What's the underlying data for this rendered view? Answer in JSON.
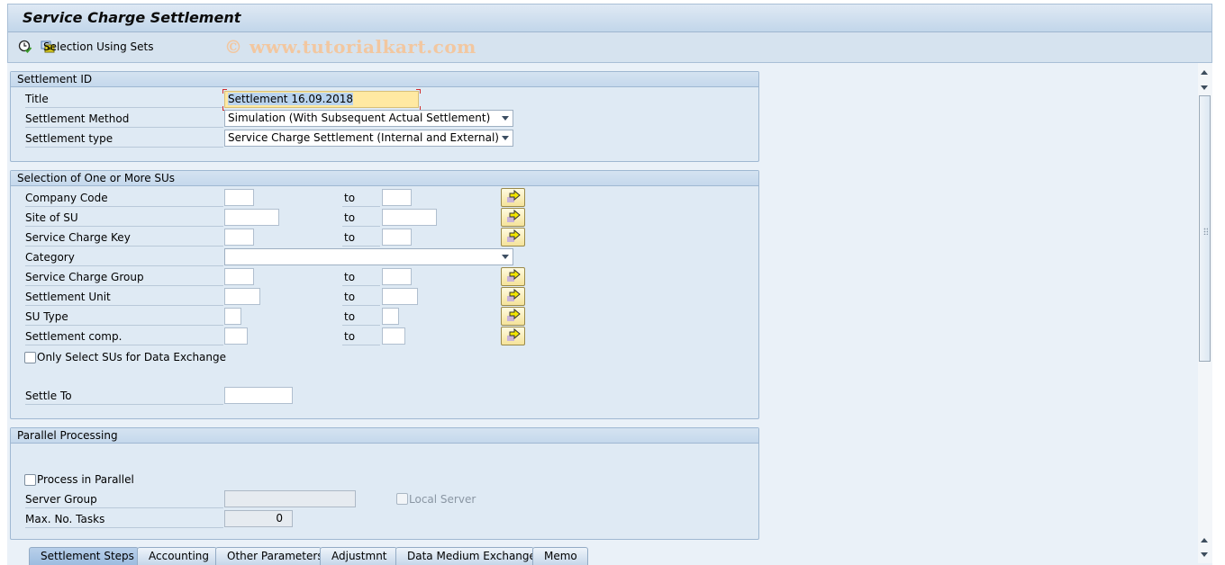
{
  "window": {
    "title": "Service Charge Settlement"
  },
  "toolbar": {
    "execute_icon": "execute-clock-icon",
    "selection_sets_label": "Selection Using Sets",
    "selection_sets_icon": "selection-sets-icon",
    "watermark": "© www.tutorialkart.com"
  },
  "settlement_id": {
    "header": "Settlement ID",
    "title_label": "Title",
    "title_value": "Settlement 16.09.2018",
    "method_label": "Settlement Method",
    "method_value": "Simulation (With Subsequent Actual Settlement)",
    "type_label": "Settlement type",
    "type_value": "Service Charge Settlement (Internal and External)"
  },
  "selection": {
    "header": "Selection of One or More SUs",
    "to_label": "to",
    "rows": [
      {
        "label": "Company Code",
        "from": "",
        "to": ""
      },
      {
        "label": "Site of SU",
        "from": "",
        "to": ""
      },
      {
        "label": "Service Charge Key",
        "from": "",
        "to": ""
      },
      {
        "label": "Category",
        "value": ""
      },
      {
        "label": "Service Charge Group",
        "from": "",
        "to": ""
      },
      {
        "label": "Settlement Unit",
        "from": "",
        "to": ""
      },
      {
        "label": "SU Type",
        "from": "",
        "to": ""
      },
      {
        "label": "Settlement comp.",
        "from": "",
        "to": ""
      }
    ],
    "data_exchange_label": "Only Select SUs for Data Exchange",
    "data_exchange_checked": false,
    "settle_to_label": "Settle To",
    "settle_to_value": ""
  },
  "parallel": {
    "header": "Parallel Processing",
    "process_label": "Process in Parallel",
    "process_checked": false,
    "server_group_label": "Server Group",
    "server_group_value": "",
    "local_server_label": "Local Server",
    "local_server_checked": false,
    "max_tasks_label": "Max. No. Tasks",
    "max_tasks_value": "0"
  },
  "tabs": [
    {
      "label": "Settlement Steps",
      "active": true
    },
    {
      "label": "Accounting",
      "active": false
    },
    {
      "label": "Other Parameters",
      "active": false
    },
    {
      "label": "Adjustmnt",
      "active": false
    },
    {
      "label": "Data Medium Exchange",
      "active": false
    },
    {
      "label": "Memo",
      "active": false
    }
  ]
}
